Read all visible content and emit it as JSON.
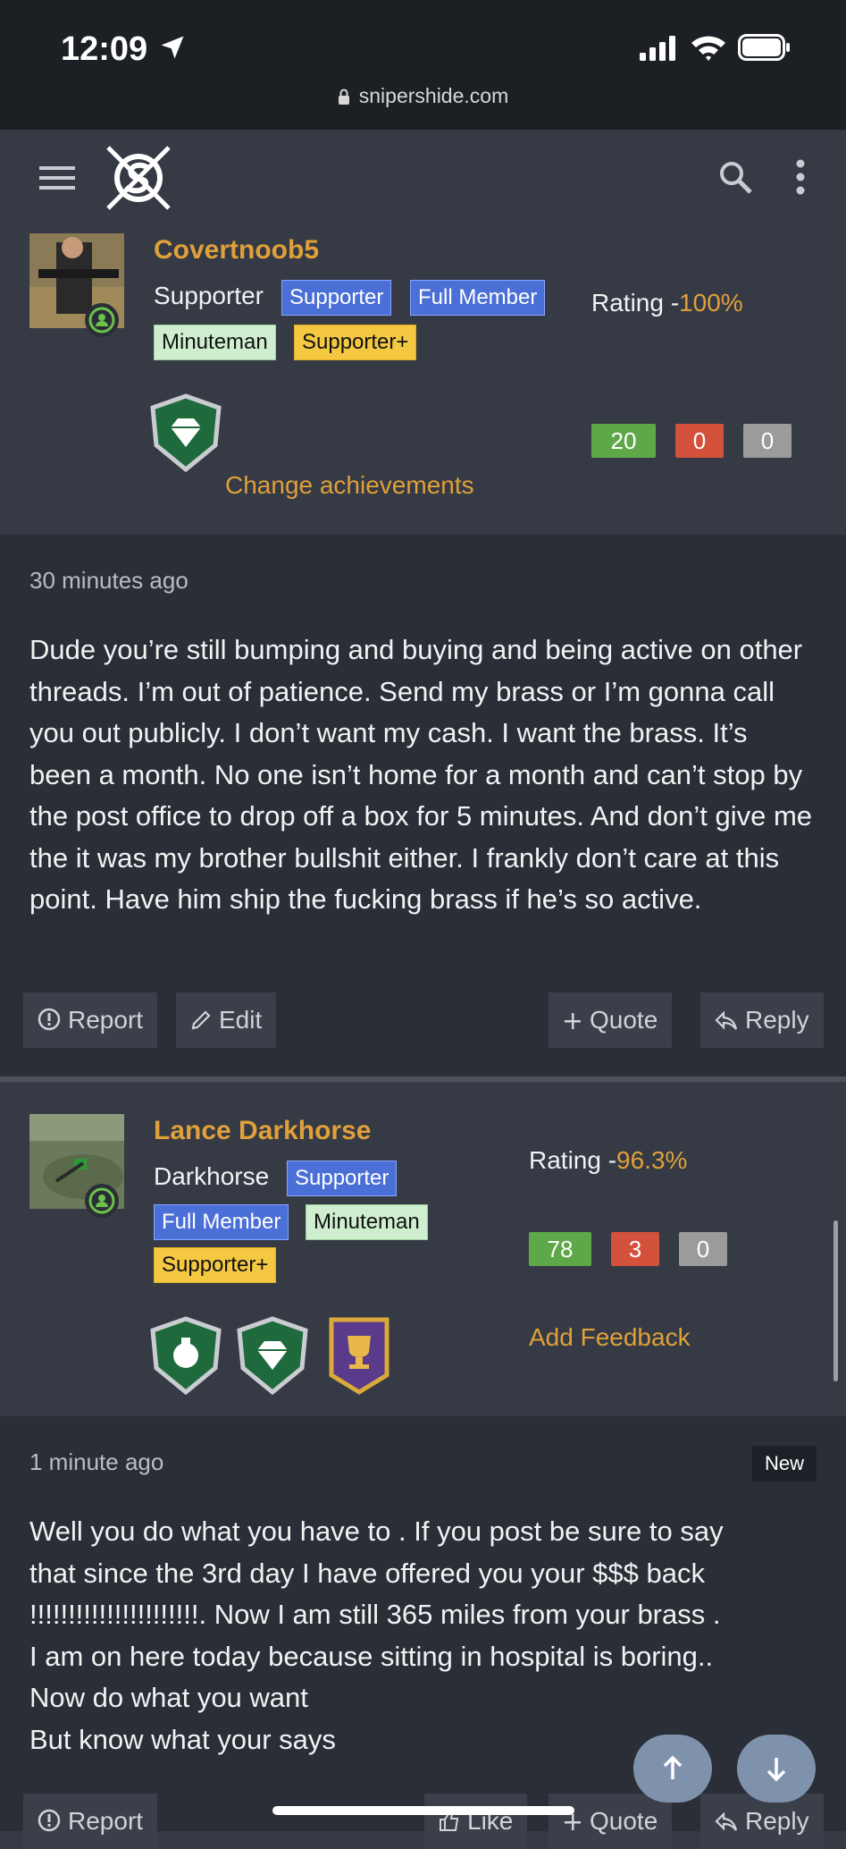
{
  "status": {
    "time": "12:09"
  },
  "browser": {
    "url": "snipershide.com"
  },
  "post1_user": {
    "name": "Covertnoob5",
    "title": "Supporter",
    "tags": [
      "Supporter",
      "Full Member",
      "Minuteman",
      "Supporter+"
    ],
    "rating_label": "Rating -",
    "rating_value": "100%",
    "feedback": {
      "positive": "20",
      "negative": "0",
      "neutral": "0"
    },
    "change_achievements": "Change achievements"
  },
  "post1": {
    "time_ago": "30 minutes ago",
    "body": "Dude you’re still bumping and buying and being active on other threads. I’m out of patience. Send my brass or I’m gonna call you out publicly. I don’t want my cash. I want the brass. It’s been a month. No one isn’t home for a month and can’t stop by the post office to drop off a box for 5 minutes. And don’t give me the it was my brother bullshit either. I frankly don’t care at this point. Have him ship the fucking brass if he’s so active.",
    "actions": {
      "report": "Report",
      "edit": "Edit",
      "quote": "Quote",
      "reply": "Reply"
    }
  },
  "post2_user": {
    "name": "Lance Darkhorse",
    "title": "Darkhorse",
    "tags": [
      "Supporter",
      "Full Member",
      "Minuteman",
      "Supporter+"
    ],
    "rating_label": "Rating -",
    "rating_value": "96.3%",
    "feedback": {
      "positive": "78",
      "negative": "3",
      "neutral": "0"
    },
    "add_feedback": "Add Feedback"
  },
  "post2": {
    "time_ago": "1 minute ago",
    "new_badge": "New",
    "body_lines": [
      "Well you do what you have to . If you post be sure to say",
      "that since the 3rd day I have offered you your $$$ back",
      "!!!!!!!!!!!!!!!!!!!!!!. Now I am still 365 miles from your brass .",
      "I am on here today because sitting in hospital is boring..",
      "Now do what you want",
      "But know what your says"
    ],
    "actions": {
      "report": "Report",
      "like": "Like",
      "quote": "Quote",
      "reply": "Reply"
    }
  },
  "colors": {
    "accent": "#e0a03a",
    "tag_blue": "#4a6fd6",
    "tag_green": "#cfeecf",
    "tag_yellow": "#f5c842"
  },
  "icons": [
    "location-arrow-icon",
    "signal-icon",
    "wifi-icon",
    "battery-icon",
    "lock-icon",
    "menu-icon",
    "site-logo",
    "search-icon",
    "more-vertical-icon",
    "online-icon",
    "diamond-badge-icon",
    "grenade-badge-icon",
    "trophy-badge-icon",
    "report-icon",
    "edit-icon",
    "plus-icon",
    "reply-icon",
    "like-icon",
    "arrow-up-icon",
    "arrow-down-icon"
  ]
}
